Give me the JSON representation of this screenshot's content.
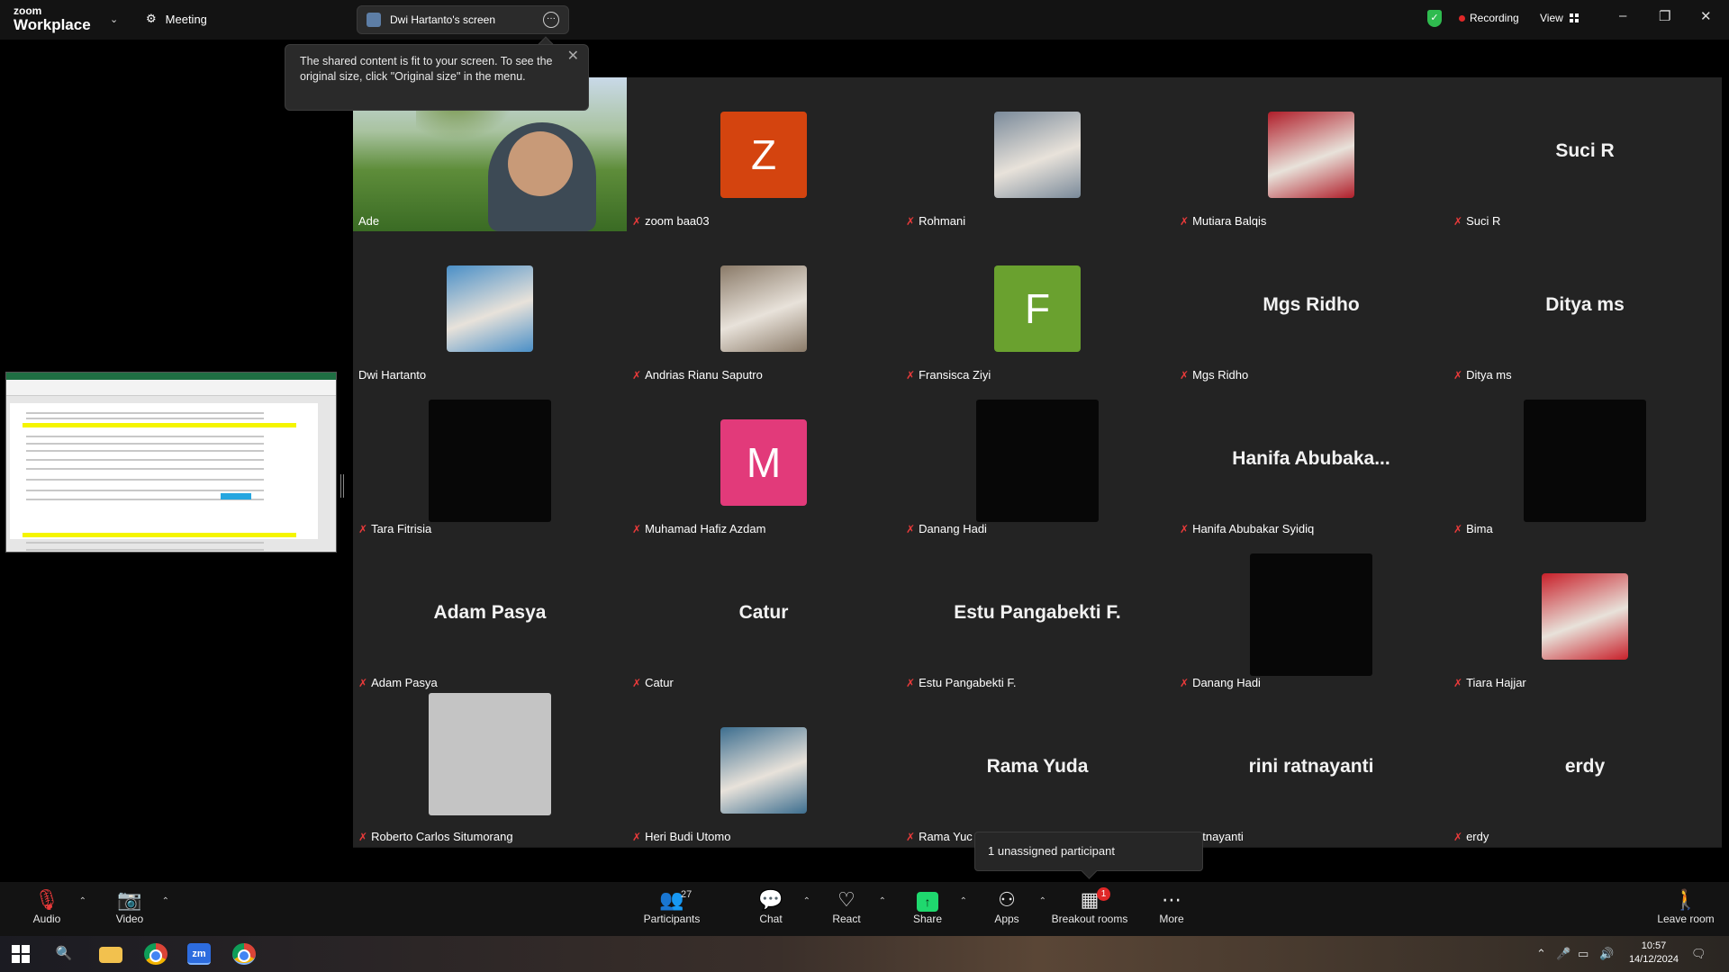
{
  "titlebar": {
    "brand_small": "zoom",
    "brand_big": "Workplace",
    "meeting_label": "Meeting",
    "shared_screen_label": "Dwi Hartanto's screen",
    "recording_label": "Recording",
    "view_label": "View",
    "minimize": "–",
    "restore": "❐",
    "close": "✕"
  },
  "tooltip": {
    "line1": "The shared content is fit to your screen. To see the",
    "line2": "original size, click \"Original size\" in the menu."
  },
  "participants": [
    {
      "name": "Ade",
      "kind": "video",
      "muted": false,
      "active": true
    },
    {
      "name": "zoom baa03",
      "kind": "letter",
      "letter": "Z",
      "color": "#d4440f",
      "muted": true
    },
    {
      "name": "Rohmani",
      "kind": "photo",
      "color": "#7a8a9a",
      "muted": true
    },
    {
      "name": "Mutiara Balqis",
      "kind": "photo",
      "color": "#b01e2a",
      "muted": true
    },
    {
      "name": "Suci R",
      "kind": "text",
      "muted": true
    },
    {
      "name": "Dwi Hartanto",
      "kind": "photo",
      "color": "#4a8fc7",
      "muted": false
    },
    {
      "name": "Andrias Rianu Saputro",
      "kind": "photo",
      "color": "#8a7a68",
      "muted": true
    },
    {
      "name": "Fransisca Ziyi",
      "kind": "letter",
      "letter": "F",
      "color": "#6aa12f",
      "muted": true
    },
    {
      "name": "Mgs Ridho",
      "kind": "text",
      "muted": true
    },
    {
      "name": "Ditya ms",
      "kind": "text",
      "muted": true
    },
    {
      "name": "Tara Fitrisia",
      "kind": "dark",
      "muted": true
    },
    {
      "name": "Muhamad Hafiz Azdam",
      "kind": "letter",
      "letter": "M",
      "color": "#e23a7a",
      "muted": true
    },
    {
      "name": "Danang Hadi",
      "kind": "dark",
      "muted": true
    },
    {
      "name": "Hanifa Abubakar Syidiq",
      "kind": "text",
      "display": "Hanifa  Abubaka...",
      "muted": true
    },
    {
      "name": "Bima",
      "kind": "dark",
      "muted": true
    },
    {
      "name": "Adam Pasya",
      "kind": "text",
      "muted": true
    },
    {
      "name": "Catur",
      "kind": "text",
      "muted": true
    },
    {
      "name": "Estu Pangabekti F.",
      "kind": "text",
      "muted": true
    },
    {
      "name": "Danang Hadi",
      "kind": "dark",
      "muted": true
    },
    {
      "name": "Tiara Hajjar",
      "kind": "photo",
      "color": "#c8202a",
      "muted": true
    },
    {
      "name": "Roberto Carlos Situmorang",
      "kind": "grey",
      "muted": true
    },
    {
      "name": "Heri Budi Utomo",
      "kind": "photo",
      "color": "#3d6e8f",
      "muted": true
    },
    {
      "name": "Rama Yuda",
      "kind": "text",
      "label": "Rama Yuc",
      "muted": true
    },
    {
      "name": "rini ratnayanti",
      "kind": "text",
      "label": "ni ratnayanti",
      "muted": false
    },
    {
      "name": "erdy",
      "kind": "text",
      "muted": true
    }
  ],
  "unassigned": "1 unassigned participant",
  "toolbar": {
    "audio": "Audio",
    "video": "Video",
    "participants": "Participants",
    "participants_count": "27",
    "chat": "Chat",
    "react": "React",
    "share": "Share",
    "apps": "Apps",
    "breakout": "Breakout rooms",
    "breakout_badge": "1",
    "more": "More",
    "leave": "Leave room"
  },
  "taskbar": {
    "time": "10:57",
    "date": "14/12/2024"
  }
}
